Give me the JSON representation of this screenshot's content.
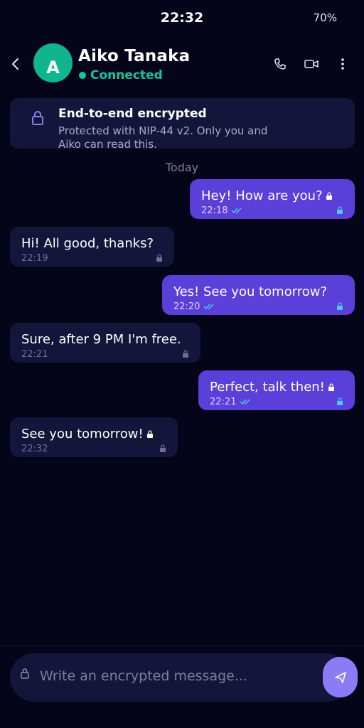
{
  "status": {
    "time": "22:32",
    "battery": "70%"
  },
  "header": {
    "avatar_initial": "A",
    "name": "Aiko Tanaka",
    "presence": "Connected",
    "icons": [
      "back-arrow-icon",
      "phone-icon",
      "video-icon",
      "more-icon"
    ]
  },
  "banner": {
    "title": "End-to-end encrypted",
    "text": "Protected with NIP-44 v2. Only you and Aiko can read this."
  },
  "date_separator": "Today",
  "messages": [
    {
      "direction": "out",
      "text": "Hey! How are you?",
      "time": "22:18"
    },
    {
      "direction": "in",
      "text": "Hi! All good, thanks?",
      "time": "22:19"
    },
    {
      "direction": "out",
      "text": "Yes! See you tomorrow?",
      "time": "22:20"
    },
    {
      "direction": "in",
      "text": "Sure, after 9 PM I'm free.",
      "time": "22:21"
    },
    {
      "direction": "out",
      "text": "Perfect, talk then!",
      "time": "22:21"
    },
    {
      "direction": "in",
      "text": "See you tomorrow!",
      "time": "22:32"
    }
  ],
  "composer": {
    "placeholder": "Write an encrypted message..."
  },
  "colors": {
    "background": "#05051a",
    "surface": "#13163a",
    "accent": "#5a3fd8",
    "send": "#8b7cf6",
    "online": "#14c79b"
  }
}
